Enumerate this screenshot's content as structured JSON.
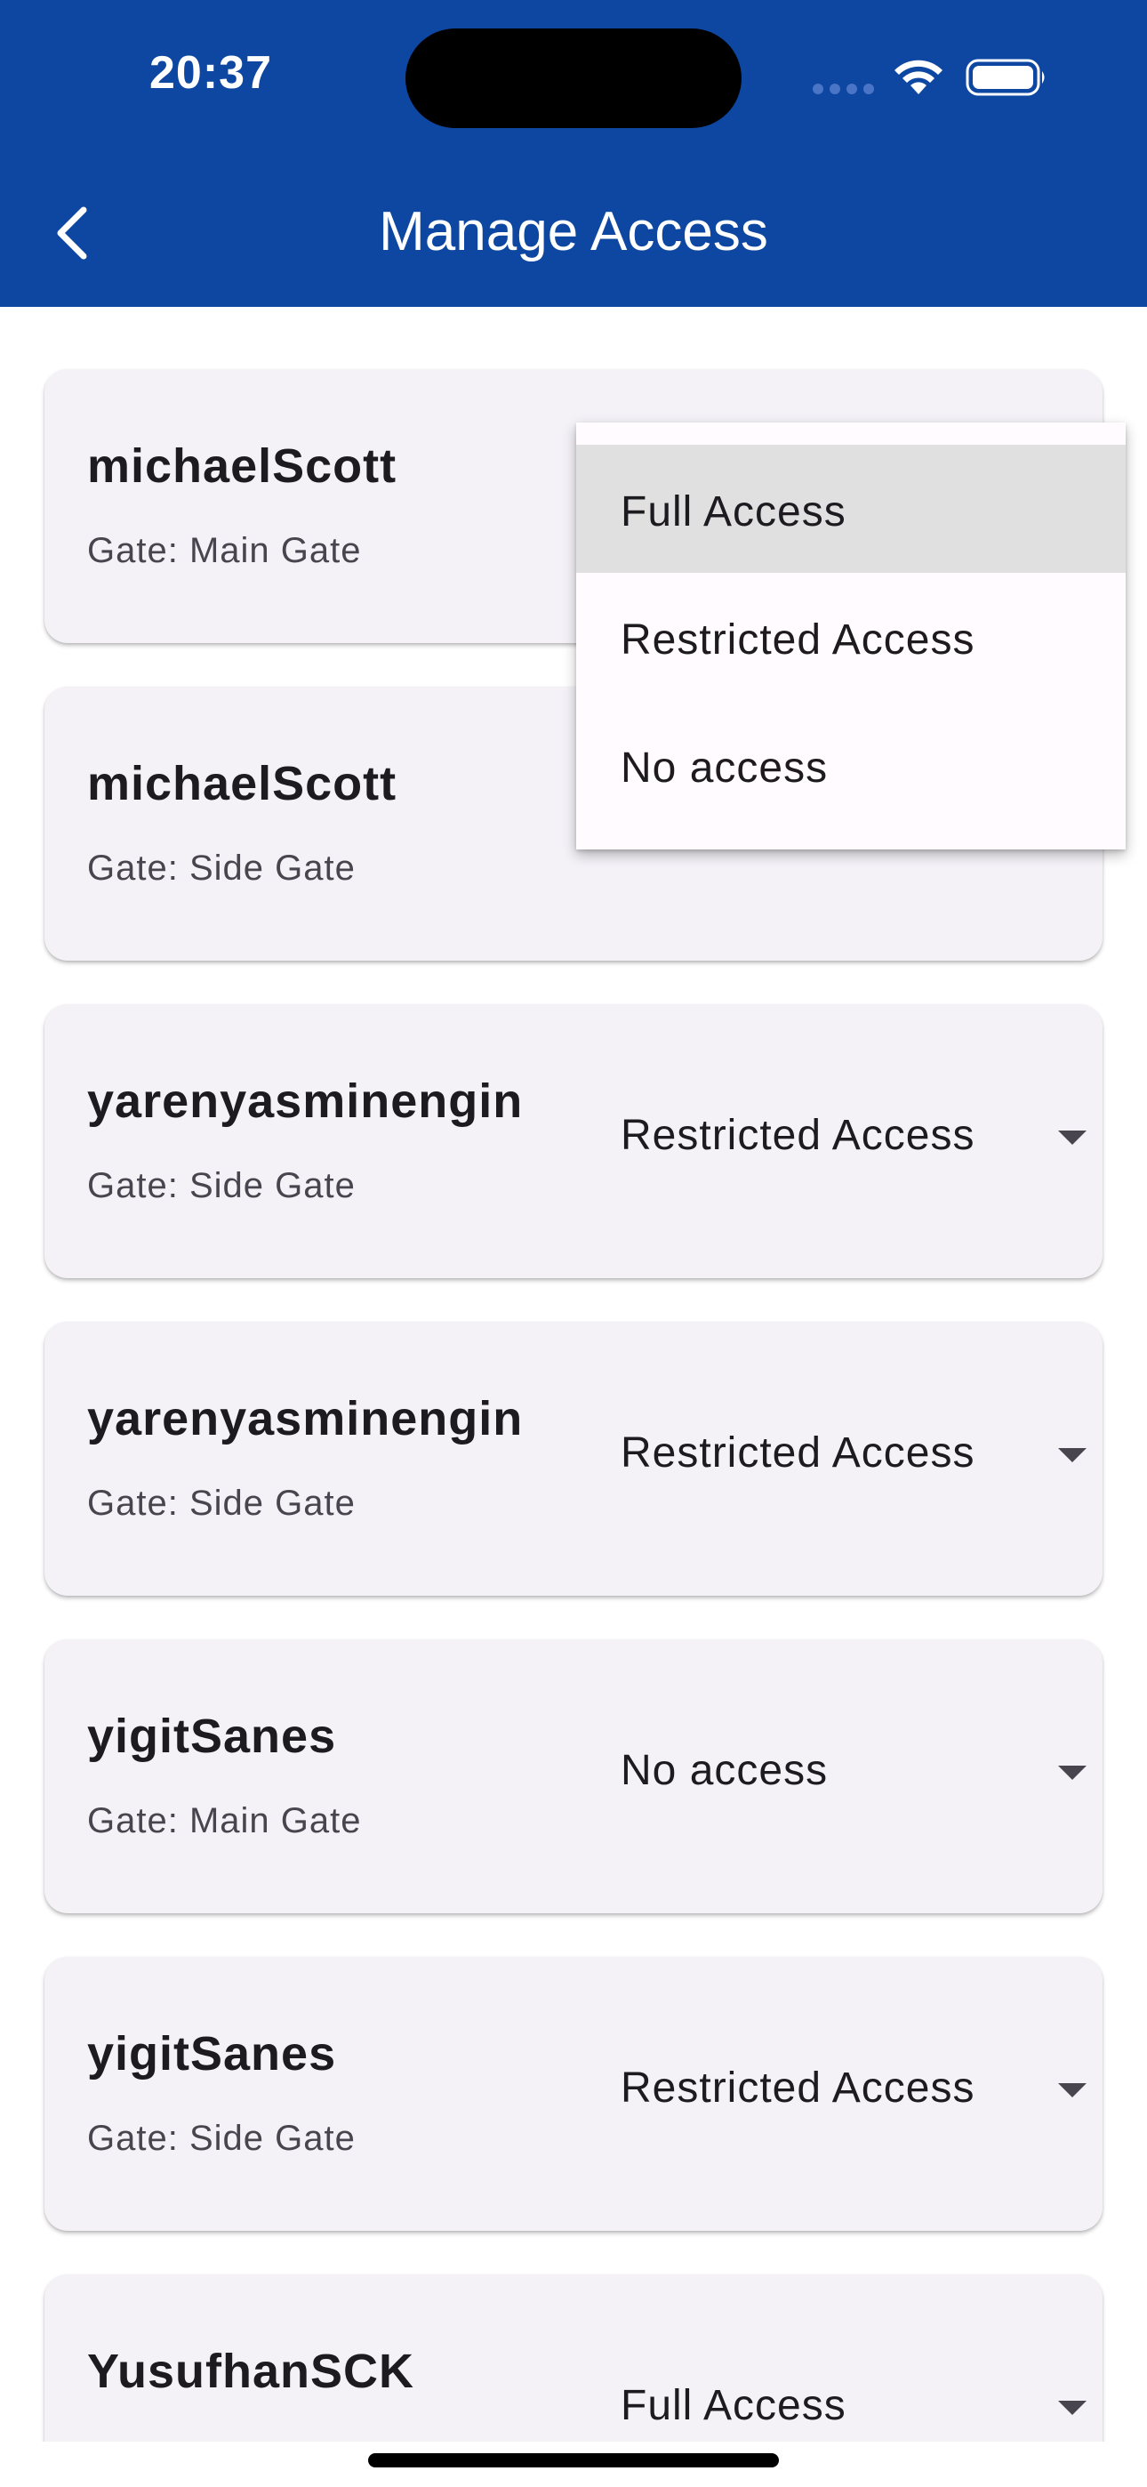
{
  "status_bar": {
    "time": "20:37"
  },
  "app_bar": {
    "title": "Manage Access",
    "background": "#0d47a1",
    "back_icon": "chevron-left-icon"
  },
  "entries": [
    {
      "username": "michaelScott",
      "gate": "Gate: Main Gate",
      "access": "Full Access"
    },
    {
      "username": "michaelScott",
      "gate": "Gate: Side Gate",
      "access": ""
    },
    {
      "username": "yarenyasminengin",
      "gate": "Gate: Side Gate",
      "access": "Restricted Access"
    },
    {
      "username": "yarenyasminengin",
      "gate": "Gate: Side Gate",
      "access": "Restricted Access"
    },
    {
      "username": "yigitSanes",
      "gate": "Gate: Main Gate",
      "access": "No access"
    },
    {
      "username": "yigitSanes",
      "gate": "Gate: Side Gate",
      "access": "Restricted Access"
    },
    {
      "username": "YusufhanSCK",
      "gate": "",
      "access": "Full Access"
    }
  ],
  "access_menu": {
    "options": [
      "Full Access",
      "Restricted Access",
      "No access"
    ],
    "selected": "Full Access"
  }
}
